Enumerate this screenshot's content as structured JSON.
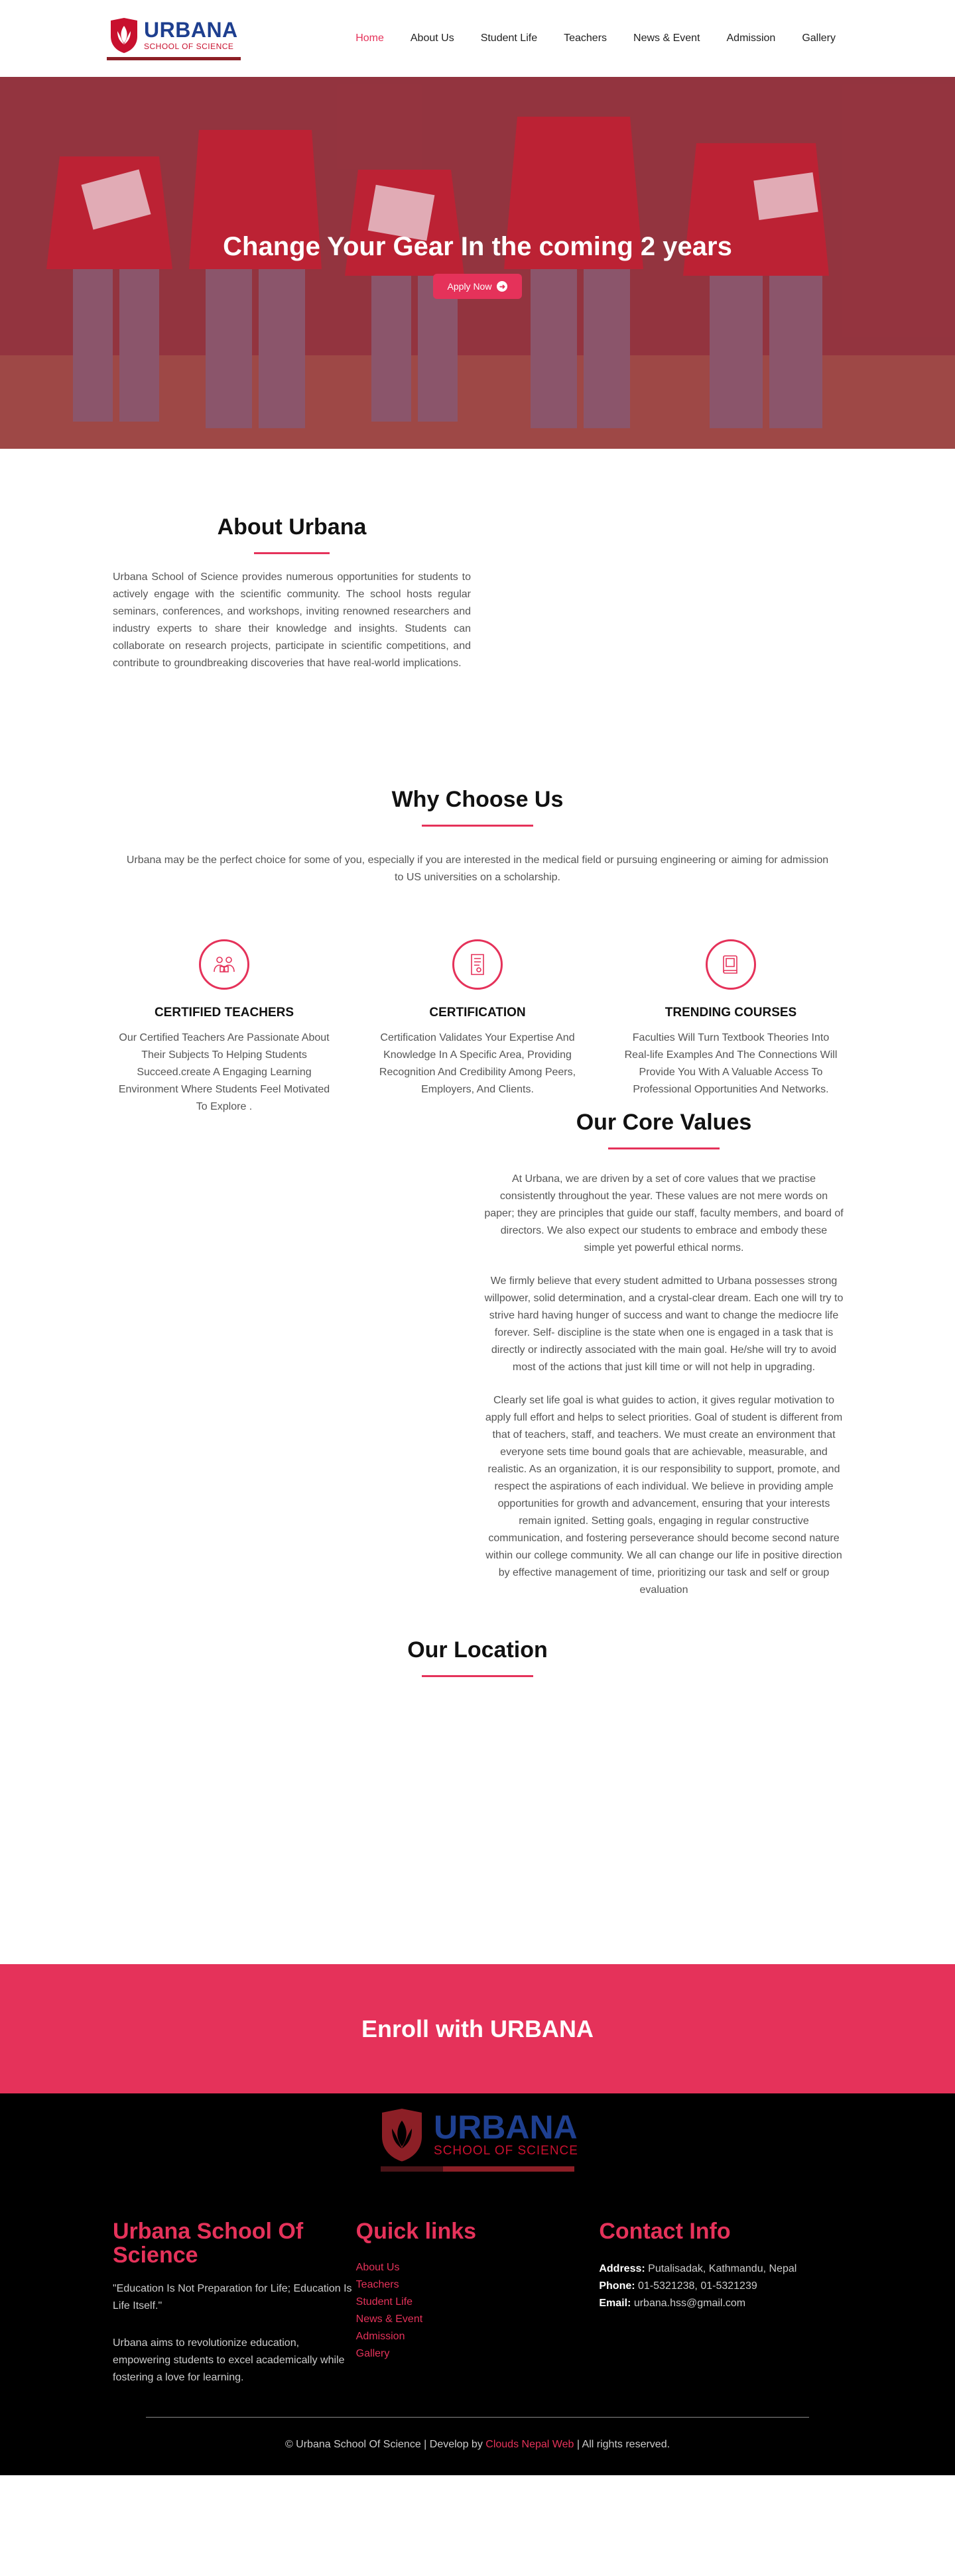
{
  "header": {
    "logo_name": "URBANA",
    "logo_sub": "SCHOOL OF SCIENCE",
    "nav": [
      "Home",
      "About Us",
      "Student Life",
      "Teachers",
      "News & Event",
      "Admission",
      "Gallery"
    ]
  },
  "hero": {
    "title": "Change Your Gear In the coming 2 years",
    "button": "Apply Now"
  },
  "about": {
    "title": "About Urbana",
    "text": "Urbana School of Science provides numerous opportunities for students to actively engage with the scientific community. The school hosts regular seminars, conferences, and workshops, inviting renowned researchers and industry experts to share their knowledge and insights. Students can collaborate on research projects, participate in scientific competitions, and contribute to groundbreaking discoveries that have real-world implications."
  },
  "why": {
    "title": "Why Choose Us",
    "lead": "Urbana may be the perfect choice for some of you, especially if you are interested in the medical field or pursuing engineering or aiming for admission to US universities on a scholarship.",
    "features": [
      {
        "title": "CERTIFIED TEACHERS",
        "text": "Our Certified Teachers Are Passionate About Their Subjects To Helping Students Succeed.create A Engaging Learning Environment Where Students Feel Motivated To Explore ."
      },
      {
        "title": "CERTIFICATION",
        "text": "Certification Validates Your Expertise And Knowledge In A Specific Area, Providing Recognition And Credibility Among Peers, Employers, And Clients."
      },
      {
        "title": "TRENDING COURSES",
        "text": "Faculties Will Turn Textbook Theories Into Real-life Examples And The Connections Will Provide You With A Valuable Access To Professional Opportunities And Networks."
      }
    ]
  },
  "core": {
    "title": "Our Core Values",
    "paragraphs": [
      "At Urbana, we are driven by a set of core values that we practise consistently throughout the year. These values are not mere words on paper; they are principles that guide our staff, faculty members, and board of directors. We also expect our students to embrace and embody these simple yet powerful ethical norms.",
      "We firmly believe that every student admitted to Urbana possesses strong willpower, solid determination, and a crystal-clear dream. Each one will try to strive hard having hunger of success and want to change the mediocre life forever. Self- discipline is the state when one is engaged in a task that is directly or indirectly associated with the main goal. He/she will try to avoid most of the actions that just kill time or will not help in upgrading.",
      "Clearly set life goal is what guides to action, it gives regular motivation to apply full effort and helps to select priorities. Goal of student is different from that of teachers, staff, and teachers. We must create an environment that everyone sets time bound goals that are achievable, measurable, and realistic. As an organization, it is our responsibility to support, promote, and respect the aspirations of each individual. We believe in providing ample opportunities for growth and advancement, ensuring that your interests remain ignited. Setting goals, engaging in regular constructive communication, and fostering perseverance should become second nature within our college community. We all can change our life in positive direction by effective management of time, prioritizing our task and self or group evaluation"
    ]
  },
  "location": {
    "title": "Our Location"
  },
  "enroll": {
    "title": "Enroll with URBANA"
  },
  "footer": {
    "logo_name": "URBANA",
    "logo_sub": "SCHOOL OF SCIENCE",
    "school_title": "Urbana School Of Science",
    "quote": "\"Education Is Not Preparation for Life; Education Is Life Itself.\"",
    "aim": "Urbana aims to revolutionize education, empowering students to excel academically while fostering a love for learning.",
    "links_title": "Quick links",
    "links": [
      "About Us",
      "Teachers",
      "Student Life",
      "News & Event",
      "Admission",
      "Gallery"
    ],
    "contact_title": "Contact Info",
    "address_label": "Address:",
    "address": "Putalisadak, Kathmandu, Nepal",
    "phone_label": "Phone:",
    "phone": "01-5321238, 01-5321239",
    "email_label": "Email:",
    "email": "urbana.hss@gmail.com",
    "copy_prefix": "© Urbana School Of Science | Develop by",
    "developer": "Clouds Nepal Web",
    "copy_suffix": "| All rights reserved."
  },
  "colors": {
    "accent": "#e5325a",
    "brand_blue": "#1e3f8f",
    "brand_red": "#c8102e"
  }
}
